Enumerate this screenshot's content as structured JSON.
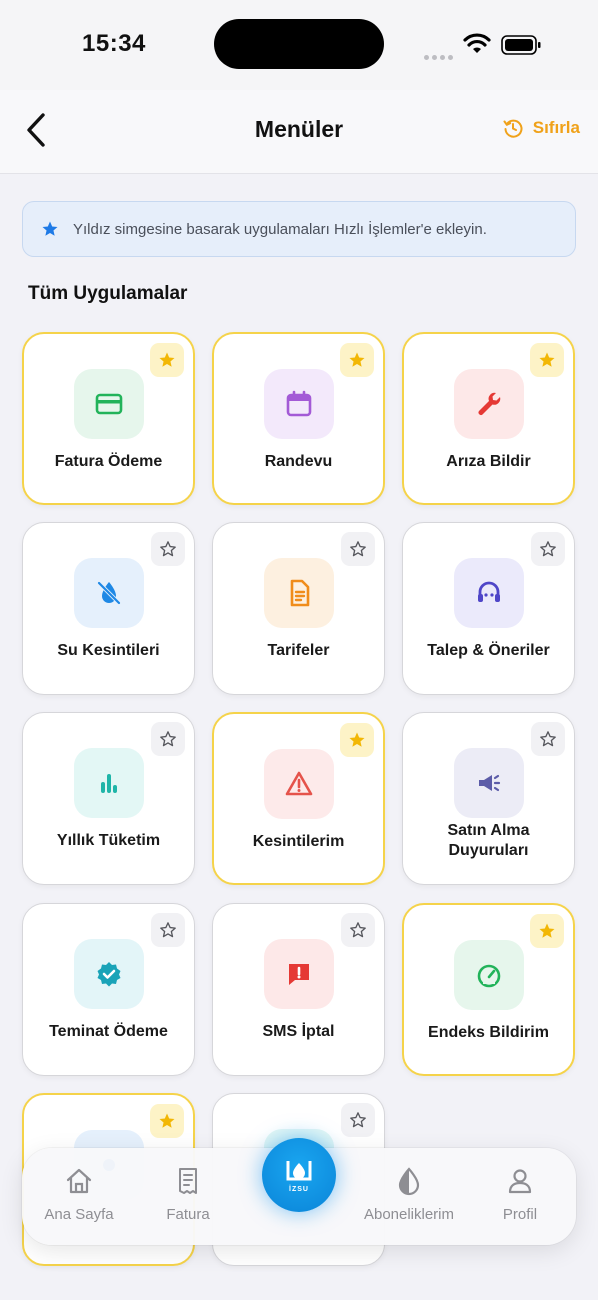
{
  "status_bar": {
    "time": "15:34"
  },
  "header": {
    "title": "Menüler",
    "reset_label": "Sıfırla"
  },
  "info_banner": {
    "text": "Yıldız simgesine basarak uygulamaları Hızlı İşlemler'e ekleyin."
  },
  "section_title": "Tüm Uygulamalar",
  "apps": [
    {
      "label": "Fatura Ödeme",
      "icon": "credit-card-icon",
      "favorite": true,
      "color": "#22b35a",
      "bg": "#e6f6ec"
    },
    {
      "label": "Randevu",
      "icon": "calendar-icon",
      "favorite": true,
      "color": "#a35ad6",
      "bg": "#f3e9fb"
    },
    {
      "label": "Arıza Bildir",
      "icon": "wrench-icon",
      "favorite": true,
      "color": "#e53935",
      "bg": "#fde8e8"
    },
    {
      "label": "Su Kesintileri",
      "icon": "water-off-icon",
      "favorite": false,
      "color": "#1e88e5",
      "bg": "#e5f0fc"
    },
    {
      "label": "Tarifeler",
      "icon": "document-icon",
      "favorite": false,
      "color": "#f08c1a",
      "bg": "#fdf0e0"
    },
    {
      "label": "Talep & Öneriler",
      "icon": "support-icon",
      "favorite": false,
      "color": "#4f46c8",
      "bg": "#ebeafb"
    },
    {
      "label": "Yıllık Tüketim",
      "icon": "bar-chart-icon",
      "favorite": false,
      "color": "#1fb5a8",
      "bg": "#e3f7f5"
    },
    {
      "label": "Kesintilerim",
      "icon": "warning-icon",
      "favorite": true,
      "color": "#e5534b",
      "bg": "#fdeaea"
    },
    {
      "label": "Satın Alma Duyuruları",
      "icon": "megaphone-icon",
      "favorite": false,
      "color": "#5c5ca8",
      "bg": "#ececf6"
    },
    {
      "label": "Teminat Ödeme",
      "icon": "verified-icon",
      "favorite": false,
      "color": "#1aa3b8",
      "bg": "#e3f5f8"
    },
    {
      "label": "SMS İptal",
      "icon": "message-alert-icon",
      "favorite": false,
      "color": "#e53935",
      "bg": "#fde8e8"
    },
    {
      "label": "Endeks Bildirim",
      "icon": "gauge-icon",
      "favorite": true,
      "color": "#22b35a",
      "bg": "#e6f6ec"
    },
    {
      "label": "",
      "icon": "",
      "favorite": true,
      "color": "#1e88e5",
      "bg": "#e5f0fc"
    },
    {
      "label": "",
      "icon": "",
      "favorite": false,
      "color": "#1fb5a8",
      "bg": "#e3f7f5"
    }
  ],
  "bottom_nav": {
    "items": [
      {
        "label": "Ana Sayfa",
        "icon": "home-icon"
      },
      {
        "label": "Fatura",
        "icon": "receipt-icon"
      },
      {
        "label": "Aboneliklerim",
        "icon": "drop-icon"
      },
      {
        "label": "Profil",
        "icon": "user-icon"
      }
    ],
    "center_label": "İZSU"
  },
  "colors": {
    "accent": "#f0a21a",
    "favorite_border": "#f5d34a",
    "center_button": "#0a84d8"
  }
}
